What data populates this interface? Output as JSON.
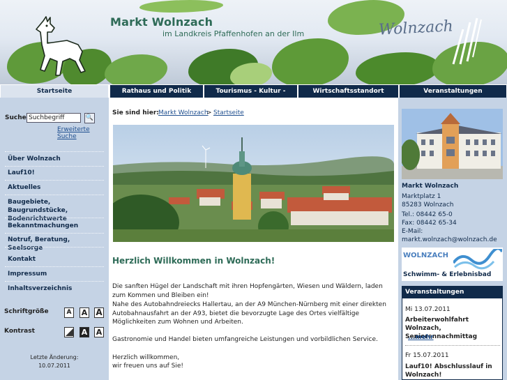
{
  "header": {
    "title": "Markt Wolnzach",
    "subtitle": "im Landkreis Pfaffenhofen an der Ilm",
    "brand": "Wolnzach"
  },
  "nav": {
    "items": [
      {
        "label": "Startseite"
      },
      {
        "label": "Rathaus und Politik"
      },
      {
        "label": "Tourismus - Kultur - Freizeit"
      },
      {
        "label": "Wirtschaftsstandort"
      },
      {
        "label": "Veranstaltungen"
      }
    ]
  },
  "search": {
    "label": "Suche",
    "value": "Suchbegriff",
    "button": "🔍",
    "advanced": "Erweiterte Suche"
  },
  "menu": [
    {
      "label": "Über Wolnzach"
    },
    {
      "label": "Lauf10!"
    },
    {
      "label": "Aktuelles"
    },
    {
      "label": "Baugebiete, Baugrundstücke, Bodenrichtwerte"
    },
    {
      "label": "Bekanntmachungen"
    },
    {
      "label": "Notruf, Beratung, Seelsorge"
    },
    {
      "label": "Kontakt"
    },
    {
      "label": "Impressum"
    },
    {
      "label": "Inhaltsverzeichnis"
    }
  ],
  "controls": {
    "fontsize_label": "Schriftgröße",
    "contrast_label": "Kontrast",
    "font_buttons": [
      "A",
      "A",
      "A"
    ],
    "contrast_buttons": [
      "",
      "A",
      "A"
    ]
  },
  "last_change": {
    "label": "Letzte Änderung:",
    "date": "10.07.2011"
  },
  "breadcrumb": {
    "label": "Sie sind hier:",
    "items": [
      "Markt Wolnzach",
      "Startseite"
    ],
    "separator": ">"
  },
  "main": {
    "heading": "Herzlich Willkommen in Wolnzach!",
    "p1": "Die sanften Hügel der Landschaft mit ihren Hopfengärten, Wiesen und Wäldern, laden zum Kommen und Bleiben ein!",
    "p2": "Nahe des Autobahndreiecks Hallertau, an der A9 München-Nürnberg mit einer direkten Autobahnausfahrt an der A93, bietet die bevorzugte Lage des Ortes vielfältige Möglichkeiten zum Wohnen und Arbeiten.",
    "p3": "Gastronomie und Handel bieten umfangreiche Leistungen und vorbildlichen Service.",
    "p4a": "Herzlich willkommen,",
    "p4b": "wir freuen uns auf Sie!"
  },
  "address": {
    "name": "Markt Wolnzach",
    "street": "Marktplatz 1",
    "city": "85283 Wolnzach",
    "tel": "Tel.: 08442 65-0",
    "fax": "Fax: 08442 65-34",
    "email_label": "E-Mail:",
    "email": "markt.wolnzach@wolnzach.de"
  },
  "bad": {
    "title": "WOLNZACH",
    "subtitle": "Schwimm- & Erlebnisbad"
  },
  "events": {
    "heading": "Veranstaltungen",
    "items": [
      {
        "date": "Mi 13.07.2011",
        "title": "Arbeiterwohlfahrt Wolnzach, Seniorennachmittag",
        "more": "...mehr"
      },
      {
        "date": "Fr 15.07.2011",
        "title": "Lauf10! Abschlusslauf in Wolnzach!"
      }
    ]
  },
  "colors": {
    "navy": "#102a4a",
    "green_title": "#2e6b57",
    "sidebar": "#c5d3e5",
    "link": "#1f4f8f"
  }
}
